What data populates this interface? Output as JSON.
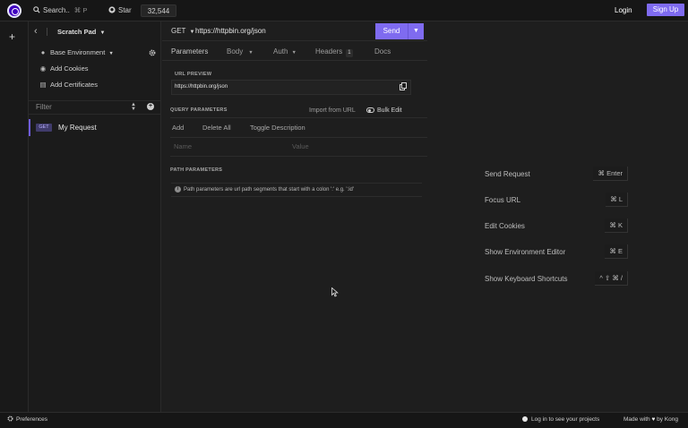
{
  "topbar": {
    "search_label": "Search..",
    "search_shortcut": "⌘ P",
    "star_label": "Star",
    "star_count": "32,544",
    "login_label": "Login",
    "signup_label": "Sign Up"
  },
  "sidebar": {
    "add_icon": "+",
    "back_icon": "‹",
    "project_name": "Scratch Pad",
    "environment": "Base Environment",
    "add_cookies": "Add Cookies",
    "add_certificates": "Add Certificates",
    "filter_placeholder": "Filter",
    "request": {
      "method": "GET",
      "name": "My Request"
    }
  },
  "request_bar": {
    "method": "GET",
    "url": "https://httpbin.org/json",
    "send_label": "Send"
  },
  "tabs": [
    {
      "label": "Parameters"
    },
    {
      "label": "Body"
    },
    {
      "label": "Auth"
    },
    {
      "label": "Headers",
      "count": "1"
    },
    {
      "label": "Docs"
    }
  ],
  "url_preview": {
    "label": "URL PREVIEW",
    "value": "https://httpbin.org/json"
  },
  "query_params": {
    "label": "QUERY PARAMETERS",
    "import_label": "Import from URL",
    "bulk_edit_label": "Bulk Edit",
    "add_label": "Add",
    "delete_all_label": "Delete All",
    "toggle_description_label": "Toggle Description",
    "name_placeholder": "Name",
    "value_placeholder": "Value"
  },
  "path_params": {
    "label": "PATH PARAMETERS",
    "info_text": "Path parameters are url path segments that start with a colon ':' e.g. ':id'"
  },
  "shortcuts": [
    {
      "label": "Send Request",
      "key": "⌘ Enter"
    },
    {
      "label": "Focus URL",
      "key": "⌘ L"
    },
    {
      "label": "Edit Cookies",
      "key": "⌘ K"
    },
    {
      "label": "Show Environment Editor",
      "key": "⌘ E"
    },
    {
      "label": "Show Keyboard Shortcuts",
      "key": "^ ⇧ ⌘ /"
    }
  ],
  "statusbar": {
    "preferences_label": "Preferences",
    "login_prompt": "Log in to see your projects",
    "made_with_prefix": "Made with",
    "made_with_suffix": "by Kong"
  },
  "colors": {
    "accent": "#7f6bf0",
    "background": "#1e1e1e",
    "topbar": "#161616"
  }
}
